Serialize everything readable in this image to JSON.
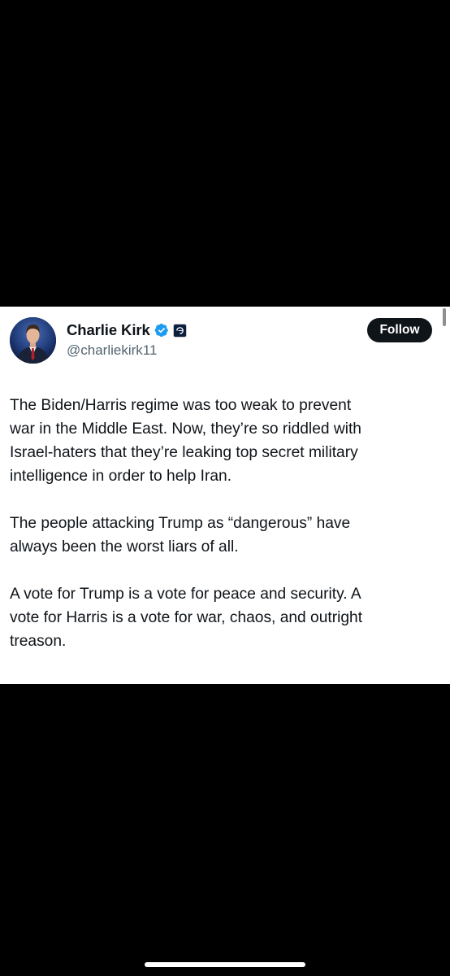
{
  "tweet": {
    "author": {
      "display_name": "Charlie Kirk",
      "handle": "@charliekirk11",
      "verified_icon": "verified-badge-icon",
      "affiliation_icon": "organization-badge-icon",
      "avatar_icon": "profile-photo"
    },
    "follow_label": "Follow",
    "paragraphs": [
      "The Biden/Harris regime was too weak to prevent\nwar in the Middle East. Now, they’re so riddled with\nIsrael-haters that they’re leaking top secret military\nintelligence in order to help Iran.",
      "The people attacking Trump as “dangerous” have\nalways been the worst liars of all.",
      "A vote for Trump is a vote for peace and security. A\nvote for Harris is a vote for war, chaos, and outright\ntreason."
    ]
  },
  "colors": {
    "background": "#000000",
    "card": "#ffffff",
    "text_primary": "#0f1419",
    "text_secondary": "#536471",
    "verified_blue": "#1d9bf0",
    "button": "#0f1419"
  }
}
